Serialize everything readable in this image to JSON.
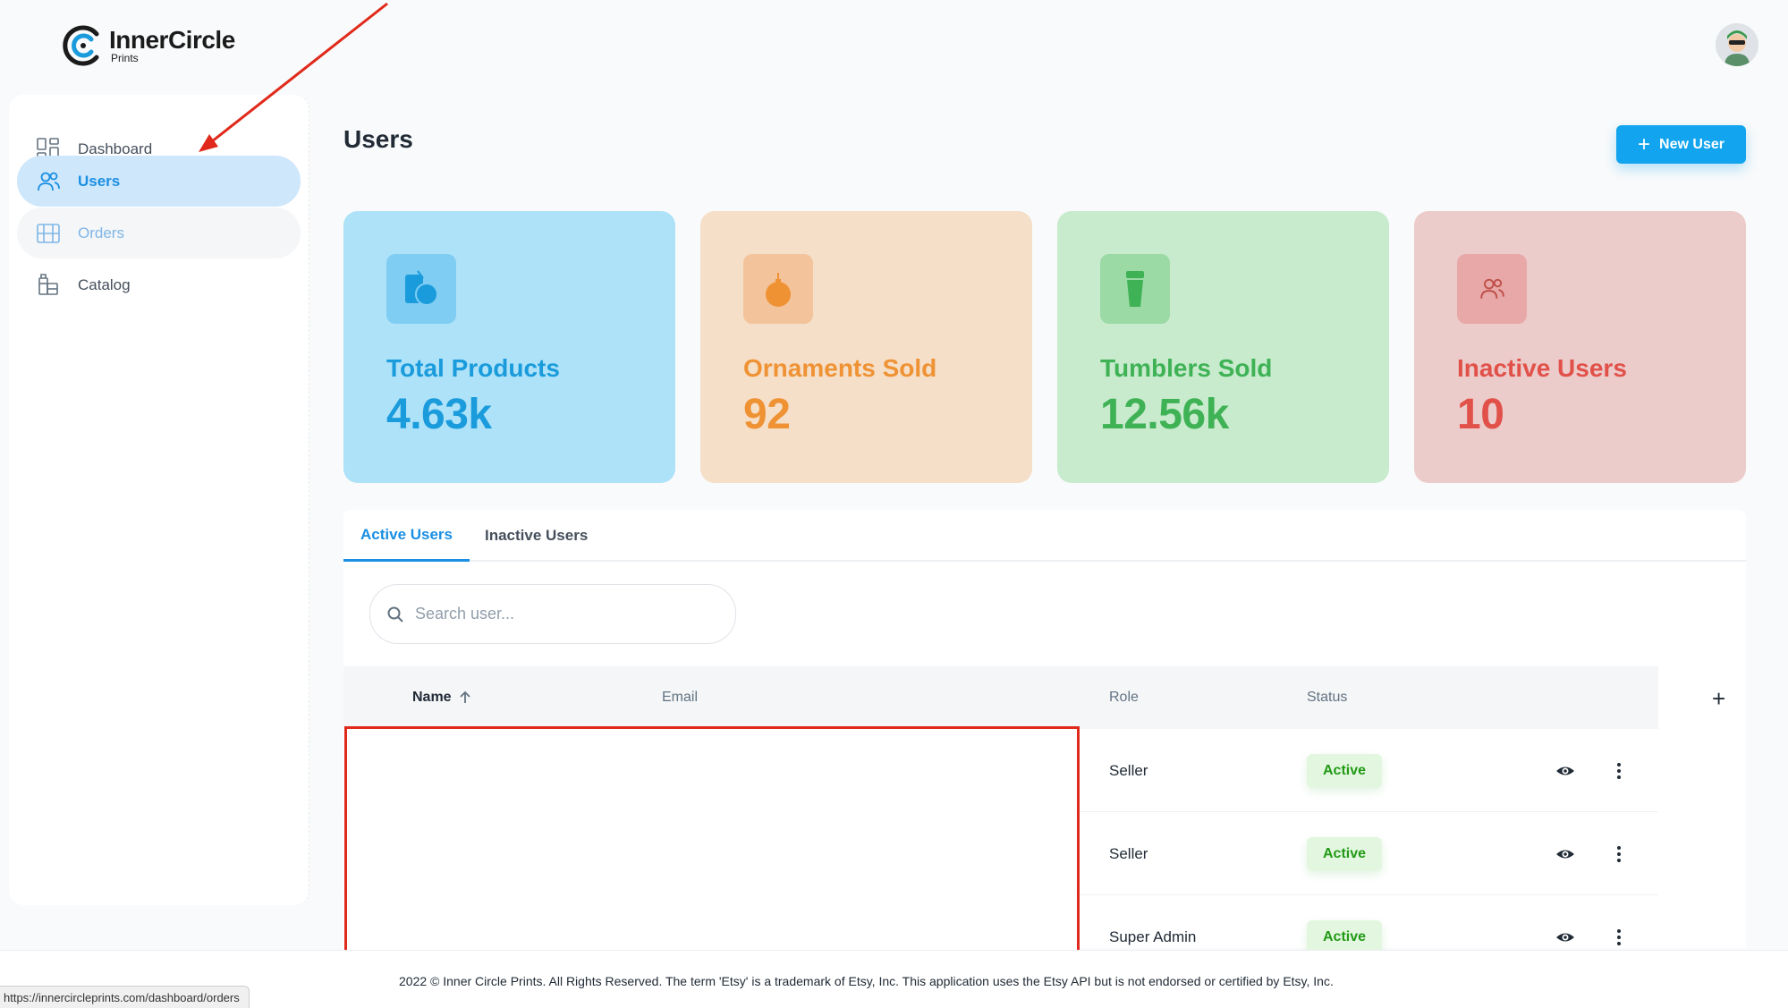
{
  "brand": {
    "name": "InnerCircle",
    "sub": "Prints"
  },
  "nav": {
    "items": [
      {
        "label": "Dashboard",
        "icon": "dashboard-icon",
        "state": "normal"
      },
      {
        "label": "Users",
        "icon": "users-icon",
        "state": "active"
      },
      {
        "label": "Orders",
        "icon": "orders-icon",
        "state": "hover"
      },
      {
        "label": "Catalog",
        "icon": "catalog-icon",
        "state": "normal"
      }
    ]
  },
  "header": {
    "title": "Users",
    "new_user_label": "New User"
  },
  "stats": [
    {
      "label": "Total Products",
      "value": "4.63k",
      "icon": "product-icon",
      "bg": "#ade2f8",
      "icon_bg": "#7fcdf2",
      "color": "#1a9bdc"
    },
    {
      "label": "Ornaments Sold",
      "value": "92",
      "icon": "ornament-icon",
      "bg": "#f5dfc8",
      "icon_bg": "#f3c39b",
      "color": "#ef9234"
    },
    {
      "label": "Tumblers Sold",
      "value": "12.56k",
      "icon": "tumbler-icon",
      "bg": "#c8ebcd",
      "icon_bg": "#9bd9a5",
      "color": "#3eb255"
    },
    {
      "label": "Inactive Users",
      "value": "10",
      "icon": "inactive-users-icon",
      "bg": "#eccbcb",
      "icon_bg": "#e8a8a8",
      "color": "#e15149"
    }
  ],
  "tabs": [
    {
      "label": "Active Users",
      "active": true
    },
    {
      "label": "Inactive Users",
      "active": false
    }
  ],
  "search": {
    "placeholder": "Search user..."
  },
  "table": {
    "columns": {
      "name": "Name",
      "email": "Email",
      "role": "Role",
      "status": "Status"
    },
    "rows": [
      {
        "role": "Seller",
        "status": "Active"
      },
      {
        "role": "Seller",
        "status": "Active"
      },
      {
        "role": "Super Admin",
        "status": "Active"
      }
    ]
  },
  "footer": {
    "text": "2022 © Inner Circle Prints. All Rights Reserved. The term 'Etsy' is a trademark of Etsy, Inc. This application uses the Etsy API but is not endorsed or certified by Etsy, Inc."
  },
  "status_bar": {
    "url": "https://innercircleprints.com/dashboard/orders"
  },
  "colors": {
    "accent": "#12a4ee",
    "annotation": "#e0291a"
  }
}
